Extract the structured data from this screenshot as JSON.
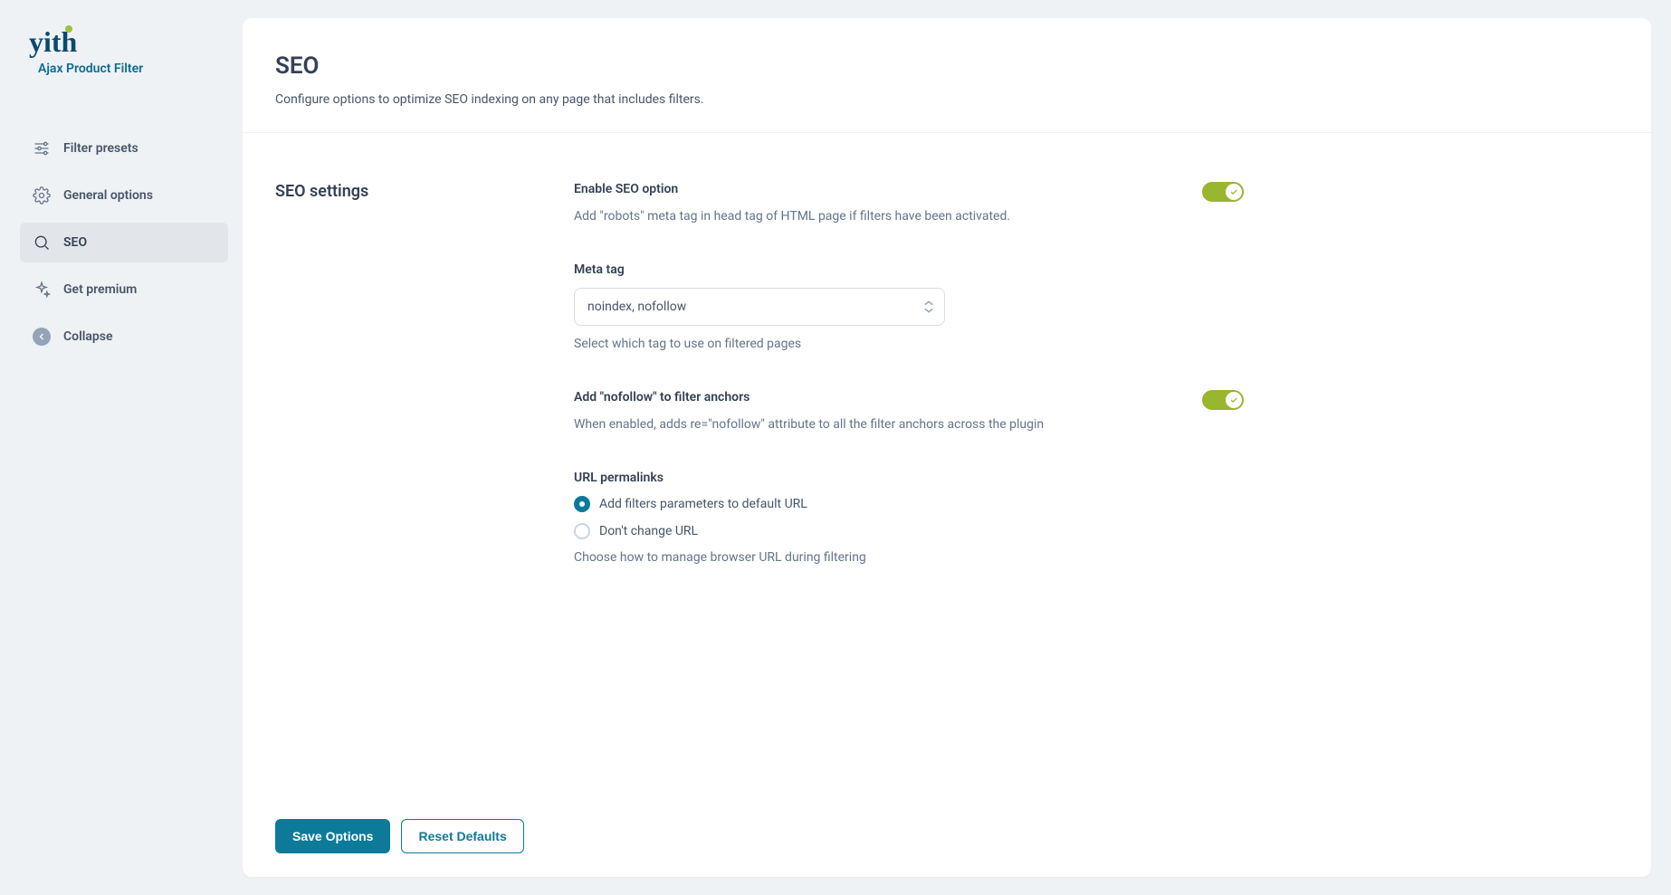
{
  "brand": {
    "logo_text": "yith",
    "subtitle": "Ajax Product Filter"
  },
  "sidebar": {
    "items": [
      {
        "label": "Filter presets"
      },
      {
        "label": "General options"
      },
      {
        "label": "SEO"
      },
      {
        "label": "Get premium"
      },
      {
        "label": "Collapse"
      }
    ]
  },
  "page": {
    "title": "SEO",
    "description": "Configure options to optimize SEO indexing on any page that includes filters."
  },
  "section": {
    "title": "SEO settings"
  },
  "fields": {
    "enable_seo": {
      "label": "Enable SEO option",
      "help": "Add \"robots\" meta tag in head tag of HTML page if filters have been activated.",
      "value": true
    },
    "meta_tag": {
      "label": "Meta tag",
      "value": "noindex, nofollow",
      "help": "Select which tag to use on filtered pages"
    },
    "nofollow": {
      "label": "Add \"nofollow\" to filter anchors",
      "help": "When enabled, adds re=\"nofollow\" attribute to all the filter anchors across the plugin",
      "value": true
    },
    "permalinks": {
      "label": "URL permalinks",
      "options": [
        "Add filters parameters to default URL",
        "Don't change URL"
      ],
      "selected": 0,
      "help": "Choose how to manage browser URL during filtering"
    }
  },
  "footer": {
    "save": "Save Options",
    "reset": "Reset Defaults"
  }
}
